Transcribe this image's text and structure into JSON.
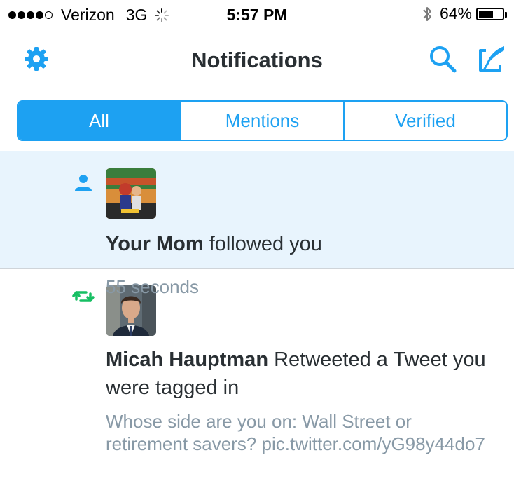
{
  "status_bar": {
    "carrier": "Verizon",
    "network": "3G",
    "time": "5:57 PM",
    "battery_percent_label": "64%",
    "battery_level": 0.64,
    "signal_bars_filled": 4,
    "signal_bars_total": 5
  },
  "nav": {
    "title": "Notifications",
    "left_icon": "gear-icon",
    "right_icons": [
      "search-icon",
      "compose-tweet-icon"
    ]
  },
  "tabs": [
    {
      "label": "All",
      "active": true
    },
    {
      "label": "Mentions",
      "active": false
    },
    {
      "label": "Verified",
      "active": false
    }
  ],
  "notifications": [
    {
      "type": "follow",
      "icon": "person-icon",
      "name": "Your Mom",
      "action": "followed you",
      "time": "55 seconds"
    },
    {
      "type": "retweet",
      "icon": "retweet-icon",
      "name": "Micah Hauptman",
      "action": "Retweeted a Tweet you were tagged in",
      "tweet_text": "Whose side are you on: Wall Street or retirement savers? pic.twitter.com/yG98y44do7"
    }
  ],
  "colors": {
    "accent": "#1da1f2",
    "retweet": "#17bf63",
    "highlight_row": "#e8f4fd",
    "secondary_text": "#8899a6",
    "primary_text": "#292f33"
  }
}
